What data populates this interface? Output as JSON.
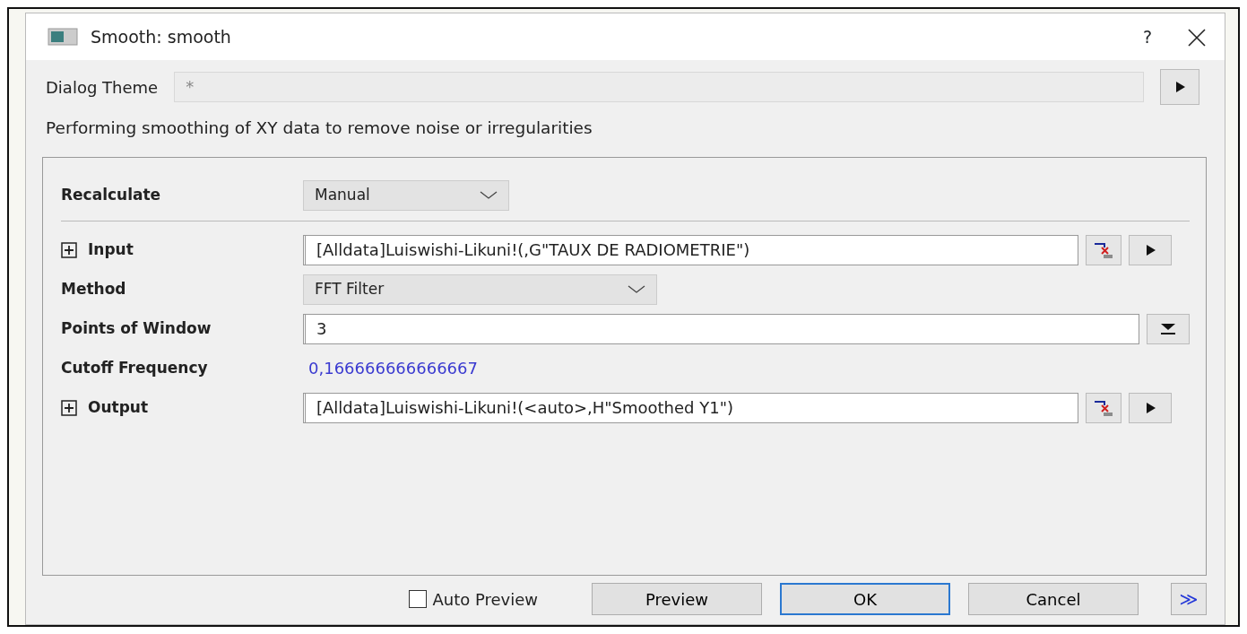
{
  "window": {
    "title": "Smooth: smooth",
    "help": "?"
  },
  "dialog_theme": {
    "label": "Dialog Theme",
    "value": "*"
  },
  "description": "Performing smoothing of XY data to remove noise or irregularities",
  "rows": [
    {
      "kind": "dropdown",
      "label": "Recalculate",
      "value": "Manual",
      "expandable": false,
      "separator_after": true
    },
    {
      "kind": "reference",
      "label": "Input",
      "value": "[Alldata]Luiswishi-Likuni!(,G\"TAUX DE RADIOMETRIE\")",
      "expandable": true,
      "separator_after": false
    },
    {
      "kind": "dropdown",
      "label": "Method",
      "value": "FFT Filter",
      "expandable": false,
      "separator_after": false
    },
    {
      "kind": "number",
      "label": "Points of Window",
      "value": "3",
      "expandable": false,
      "separator_after": false
    },
    {
      "kind": "readout",
      "label": "Cutoff Frequency",
      "value": "0,166666666666667",
      "expandable": false,
      "separator_after": false
    },
    {
      "kind": "reference",
      "label": "Output",
      "value": "[Alldata]Luiswishi-Likuni!(<auto>,H\"Smoothed Y1\")",
      "expandable": true,
      "separator_after": false
    }
  ],
  "auto_preview": {
    "label": "Auto Preview",
    "checked": false
  },
  "buttons": [
    {
      "label": "Preview",
      "default": false
    },
    {
      "label": "OK",
      "default": true
    },
    {
      "label": "Cancel",
      "default": false
    }
  ],
  "more_button": "≫"
}
